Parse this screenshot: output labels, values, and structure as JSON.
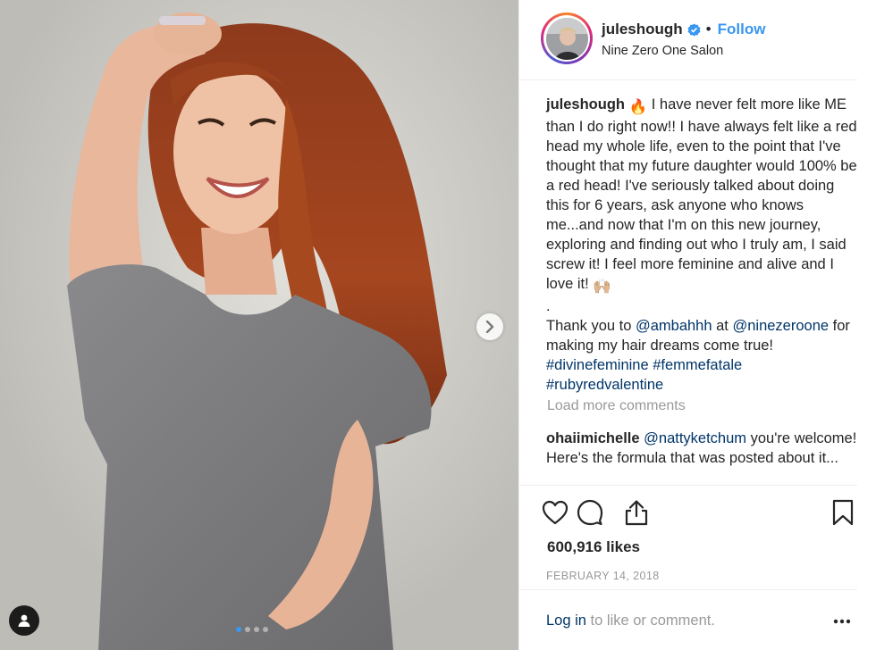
{
  "header": {
    "username": "juleshough",
    "separator": "•",
    "follow_label": "Follow",
    "location": "Nine Zero One Salon",
    "verified": true
  },
  "caption": {
    "username": "juleshough",
    "emoji_fire": "🔥",
    "text_1": " I have never felt more like ME than I do right now!! I have always felt like a red head my whole life, even to the point that I've thought that my future daughter would 100% be a red head! I've seriously talked about doing this for 6 years, ask anyone who knows me...and now that I'm on this new journey, exploring and finding out who I truly am, I said screw it! I feel more feminine and alive and I love it! ",
    "emoji_hands": "🙌🏼",
    "dot_line": ".",
    "thanks_prefix": "Thank you to ",
    "mention_1": "@ambahhh",
    "thanks_mid": " at ",
    "mention_2": "@ninezeroone",
    "thanks_suffix": " for making my hair dreams come true!",
    "hashtag_1": "#divinefeminine",
    "hashtag_2": "#femmefatale",
    "hashtag_3": "#rubyredvalentine"
  },
  "load_more_label": "Load more comments",
  "reply": {
    "username": "ohaiimichelle",
    "mention": "@nattyketchum",
    "text": " you're welcome! Here's the formula that was posted about it..."
  },
  "actions": {
    "icons": [
      "heart-icon",
      "comment-icon",
      "share-icon",
      "bookmark-icon"
    ]
  },
  "likes": "600,916 likes",
  "date": "FEBRUARY 14, 2018",
  "footer": {
    "login_label": "Log in",
    "login_suffix": " to like or comment.",
    "more_icon": "more-options-icon"
  },
  "media": {
    "carousel_count": 4,
    "carousel_active": 1,
    "next_icon": "chevron-right-icon",
    "user_tag_icon": "user-tag-icon"
  },
  "colors": {
    "accent": "#3897f0",
    "link": "#003569",
    "muted": "#999999",
    "text": "#262626"
  }
}
